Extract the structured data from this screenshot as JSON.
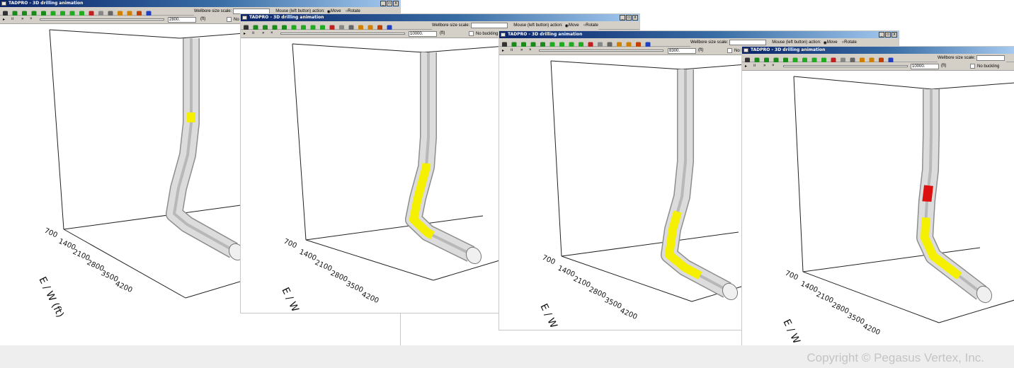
{
  "window_title": "TADPRO - 3D drilling animation",
  "window_buttons": [
    "_",
    "▫",
    "x"
  ],
  "labels": {
    "wellbore_size_scale": "Wellbore size scale:",
    "mouse_action": "Mouse (left button) action:",
    "move": "Move",
    "rotate": "Rotate",
    "no_buckling": "No buckling",
    "depth_unit": "(ft)"
  },
  "play_controls": [
    "▸",
    "ıı",
    "»",
    "×"
  ],
  "axis": {
    "ticks": [
      "700",
      "1400",
      "2100",
      "2800",
      "3500",
      "4200"
    ],
    "ew_label": "E / W (ft)"
  },
  "windows": [
    {
      "depth": "2800.",
      "yellow_band": [
        0.3,
        0.34
      ]
    },
    {
      "depth": "10000.",
      "yellow_band": [
        0.47,
        0.82
      ]
    },
    {
      "depth": "8300.",
      "yellow_band": [
        0.56,
        0.88
      ]
    },
    {
      "depth": "10000.",
      "yellow_band": [
        0.56,
        0.88
      ]
    }
  ],
  "footer": {
    "copyright": "Copyright © Pegasus Vertex, Inc."
  }
}
